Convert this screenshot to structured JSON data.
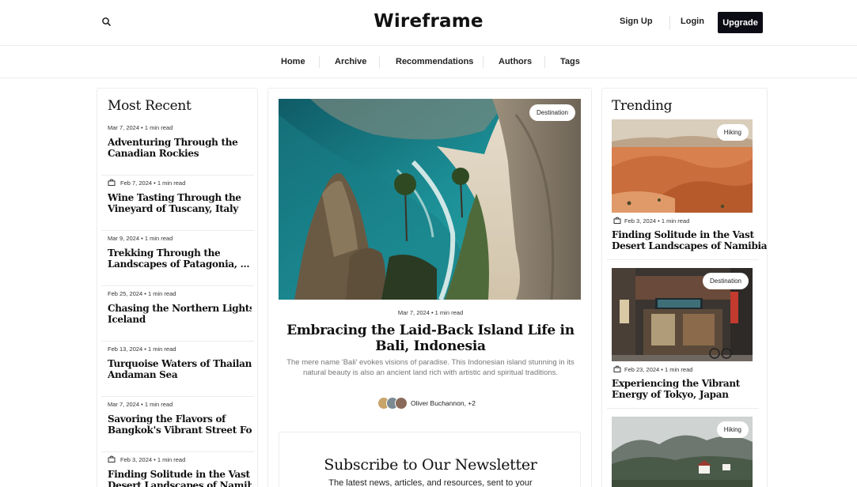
{
  "header": {
    "logo": "Wireframe",
    "signup_label": "Sign Up",
    "login_label": "Login",
    "upgrade_label": "Upgrade"
  },
  "nav": {
    "items": [
      "Home",
      "Archive",
      "Recommendations",
      "Authors",
      "Tags"
    ]
  },
  "most_recent": {
    "title": "Most Recent",
    "items": [
      {
        "date": "Mar 7, 2024",
        "read": "1 min read",
        "title": [
          "Adventuring Through the",
          "Canadian Rockies"
        ],
        "locked": false
      },
      {
        "date": "Feb 7, 2024",
        "read": "1 min read",
        "title": [
          "Wine Tasting Through the",
          "Vineyard of Tuscany, Italy"
        ],
        "locked": true
      },
      {
        "date": "Mar 9, 2024",
        "read": "1 min read",
        "title": [
          "Trekking Through the",
          "Landscapes of Patagonia, ..."
        ],
        "locked": false
      },
      {
        "date": "Feb 25, 2024",
        "read": "1 min read",
        "title": [
          "Chasing the Northern Lights in",
          "Iceland"
        ],
        "locked": false
      },
      {
        "date": "Feb 13, 2024",
        "read": "1 min read",
        "title": [
          "Turquoise Waters of Thailand's",
          "Andaman Sea"
        ],
        "locked": false
      },
      {
        "date": "Mar 7, 2024",
        "read": "1 min read",
        "title": [
          "Savoring the Flavors of",
          "Bangkok's Vibrant Street Foo..."
        ],
        "locked": false
      },
      {
        "date": "Feb 3, 2024",
        "read": "1 min read",
        "title": [
          "Finding Solitude in the Vast",
          "Desert Landscapes of Namibia"
        ],
        "locked": true
      }
    ]
  },
  "featured": {
    "tag": "Destination",
    "meta": "Mar 7, 2024 • 1 min read",
    "title": "Embracing the Laid-Back Island Life in Bali, Indonesia",
    "excerpt": "The mere name 'Bali' evokes visions of paradise. This Indonesian island stunning in its natural beauty is also an ancient land rich with artistic and spiritual traditions.",
    "authors": "Oliver Buchannon, +2"
  },
  "newsletter": {
    "title": "Subscribe to Our Newsletter",
    "subtitle": "The latest news, articles, and resources, sent to your"
  },
  "trending": {
    "title": "Trending",
    "items": [
      {
        "tag": "Hiking",
        "date": "Feb 3, 2024",
        "read": "1 min read",
        "title": [
          "Finding Solitude in the Vast",
          "Desert Landscapes of Namibia"
        ]
      },
      {
        "tag": "Destination",
        "date": "Feb 23, 2024",
        "read": "1 min read",
        "title": [
          "Experiencing the Vibrant",
          "Energy of Tokyo, Japan"
        ]
      },
      {
        "tag": "Hiking"
      }
    ]
  },
  "colors": {
    "accent": "#0c0c14",
    "border": "#ececec",
    "muted_text": "#777777"
  },
  "icons": {
    "search": "search-icon",
    "locked": "bag-icon"
  }
}
